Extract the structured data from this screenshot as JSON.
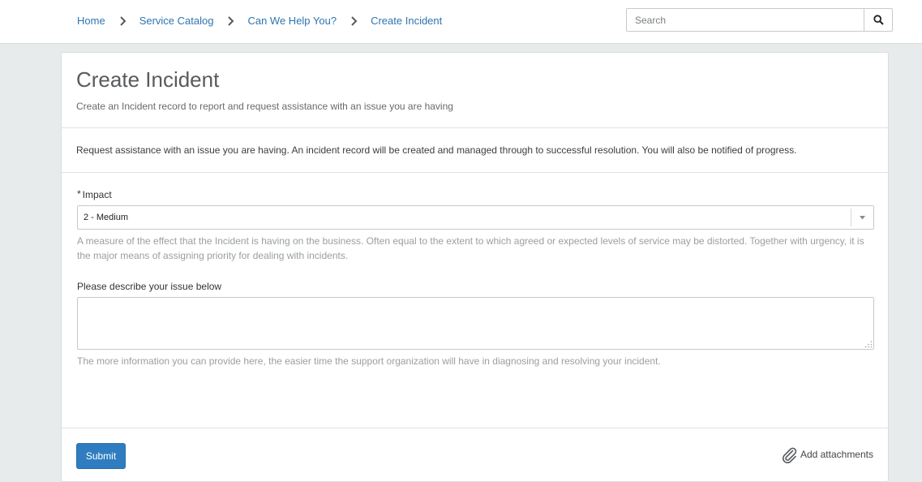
{
  "breadcrumb": {
    "items": [
      {
        "label": "Home"
      },
      {
        "label": "Service Catalog"
      },
      {
        "label": "Can We Help You?"
      },
      {
        "label": "Create Incident"
      }
    ]
  },
  "search": {
    "placeholder": "Search",
    "icon": "search-icon"
  },
  "header": {
    "title": "Create Incident",
    "subtitle": "Create an Incident record to report and request assistance with an issue you are having"
  },
  "intro": {
    "text": "Request assistance with an issue you are having. An incident record will be created and managed through to successful resolution. You will also be notified of progress."
  },
  "form": {
    "impact": {
      "required_marker": "*",
      "label": "Impact",
      "value": "2 - Medium",
      "help": "A measure of the effect that the Incident is having on the business. Often equal to the extent to which agreed or expected levels of service may be distorted. Together with urgency, it is the major means of assigning priority for dealing with incidents."
    },
    "description": {
      "label": "Please describe your issue below",
      "value": "",
      "help": "The more information you can provide here, the easier time the support organization will have in diagnosing and resolving your incident."
    }
  },
  "footer": {
    "submit_label": "Submit",
    "attachments_label": "Add attachments"
  },
  "colors": {
    "link": "#2e75b0",
    "primary_button": "#2f7dc0",
    "page_background": "#e8ebec"
  }
}
